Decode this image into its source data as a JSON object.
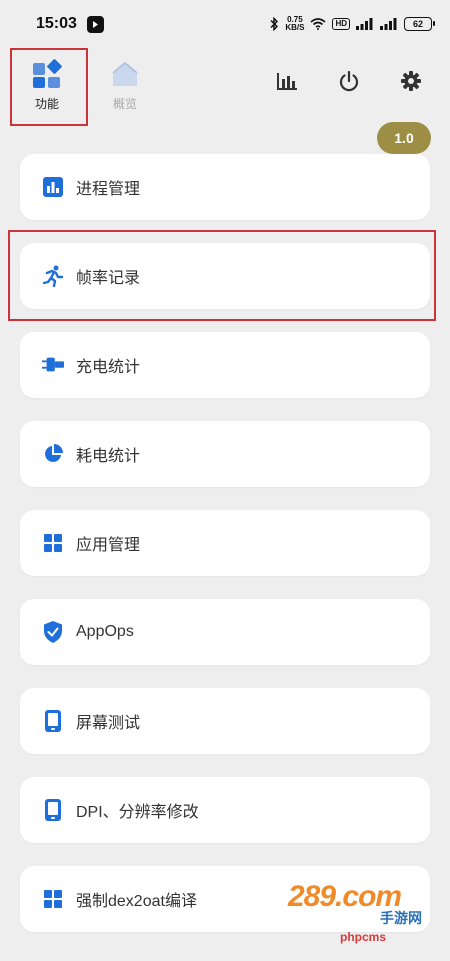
{
  "status_bar": {
    "time": "15:03",
    "net_speed_value": "0.75",
    "net_speed_unit": "KB/S",
    "hd_badge": "HD",
    "battery": "62"
  },
  "tabs": [
    {
      "label": "功能",
      "icon": "function-grid-icon",
      "active": true
    },
    {
      "label": "概览",
      "icon": "house-icon",
      "active": false
    }
  ],
  "actions": [
    {
      "icon": "bar-chart-icon"
    },
    {
      "icon": "power-icon"
    },
    {
      "icon": "gear-icon"
    }
  ],
  "version": "1.0",
  "menu": [
    {
      "label": "进程管理",
      "icon": "bar-chart-icon"
    },
    {
      "label": "帧率记录",
      "icon": "running-person-icon"
    },
    {
      "label": "充电统计",
      "icon": "charger-plug-icon"
    },
    {
      "label": "耗电统计",
      "icon": "pie-chart-icon"
    },
    {
      "label": "应用管理",
      "icon": "app-grid-icon"
    },
    {
      "label": "AppOps",
      "icon": "shield-check-icon"
    },
    {
      "label": "屏幕测试",
      "icon": "phone-screen-icon"
    },
    {
      "label": "DPI、分辨率修改",
      "icon": "phone-screen-icon"
    },
    {
      "label": "强制dex2oat编译",
      "icon": "app-grid-icon"
    }
  ],
  "watermark": {
    "logo": "289.com",
    "subtitle": "手游网",
    "site": "phpcms"
  },
  "colors": {
    "accent_blue": "#1e6fd9",
    "highlight_red": "#c8343a",
    "version_pill": "#9c8e45",
    "background": "#eeeeee"
  }
}
